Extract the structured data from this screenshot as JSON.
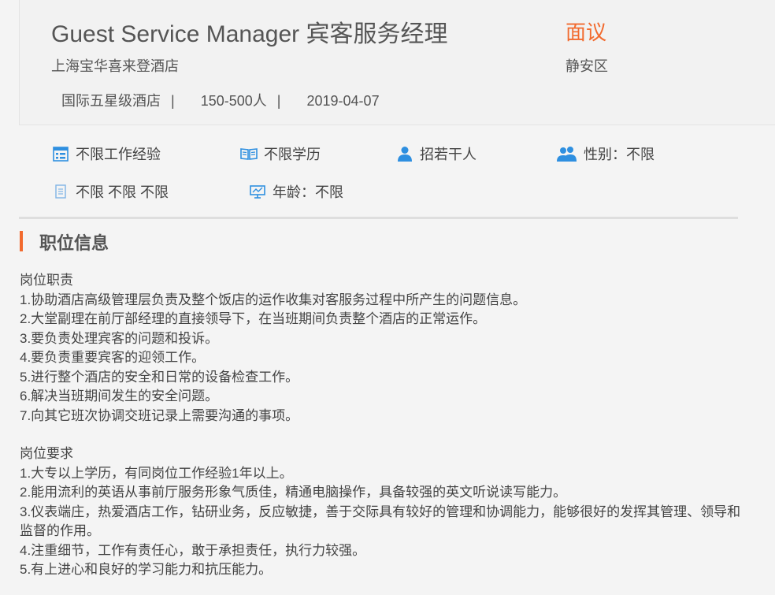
{
  "job": {
    "title": "Guest Service Manager 宾客服务经理",
    "salary": "面议",
    "company": "上海宝华喜来登酒店",
    "district": "静安区",
    "company_type": "国际五星级酒店",
    "company_size": "150-500人",
    "publish_date": "2019-04-07",
    "separator": "|"
  },
  "attributes": {
    "experience": {
      "icon": "calendar-icon",
      "label": "不限工作经验"
    },
    "education": {
      "icon": "book-icon",
      "label": "不限学历"
    },
    "headcount": {
      "icon": "person-icon",
      "label": "招若干人"
    },
    "gender": {
      "icon": "people-icon",
      "label": "性别：不限"
    },
    "misc": {
      "icon": "document-icon",
      "label": "不限 不限 不限"
    },
    "age": {
      "icon": "presentation-icon",
      "label": "年龄：不限"
    }
  },
  "colors": {
    "accent": "#f26a2e",
    "icon_blue": "#2e8fe0"
  },
  "section": {
    "title": "职位信息",
    "duties_heading": "岗位职责",
    "duties": [
      "1.协助酒店高级管理层负责及整个饭店的运作收集对客服务过程中所产生的问题信息。",
      "2.大堂副理在前厅部经理的直接领导下，在当班期间负责整个酒店的正常运作。",
      "3.要负责处理宾客的问题和投诉。",
      "4.要负责重要宾客的迎领工作。",
      "5.进行整个酒店的安全和日常的设备检查工作。",
      "6.解决当班期间发生的安全问题。",
      "7.向其它班次协调交班记录上需要沟通的事项。"
    ],
    "requirements_heading": "岗位要求",
    "requirements": [
      "1.大专以上学历，有同岗位工作经验1年以上。",
      "2.能用流利的英语从事前厅服务形象气质佳，精通电脑操作，具备较强的英文听说读写能力。",
      "3.仪表端庄，热爱酒店工作，钻研业务，反应敏捷，善于交际具有较好的管理和协调能力，能够很好的发挥其管理、领导和监督的作用。",
      "4.注重细节，工作有责任心，敢于承担责任，执行力较强。",
      "5.有上进心和良好的学习能力和抗压能力。"
    ]
  }
}
